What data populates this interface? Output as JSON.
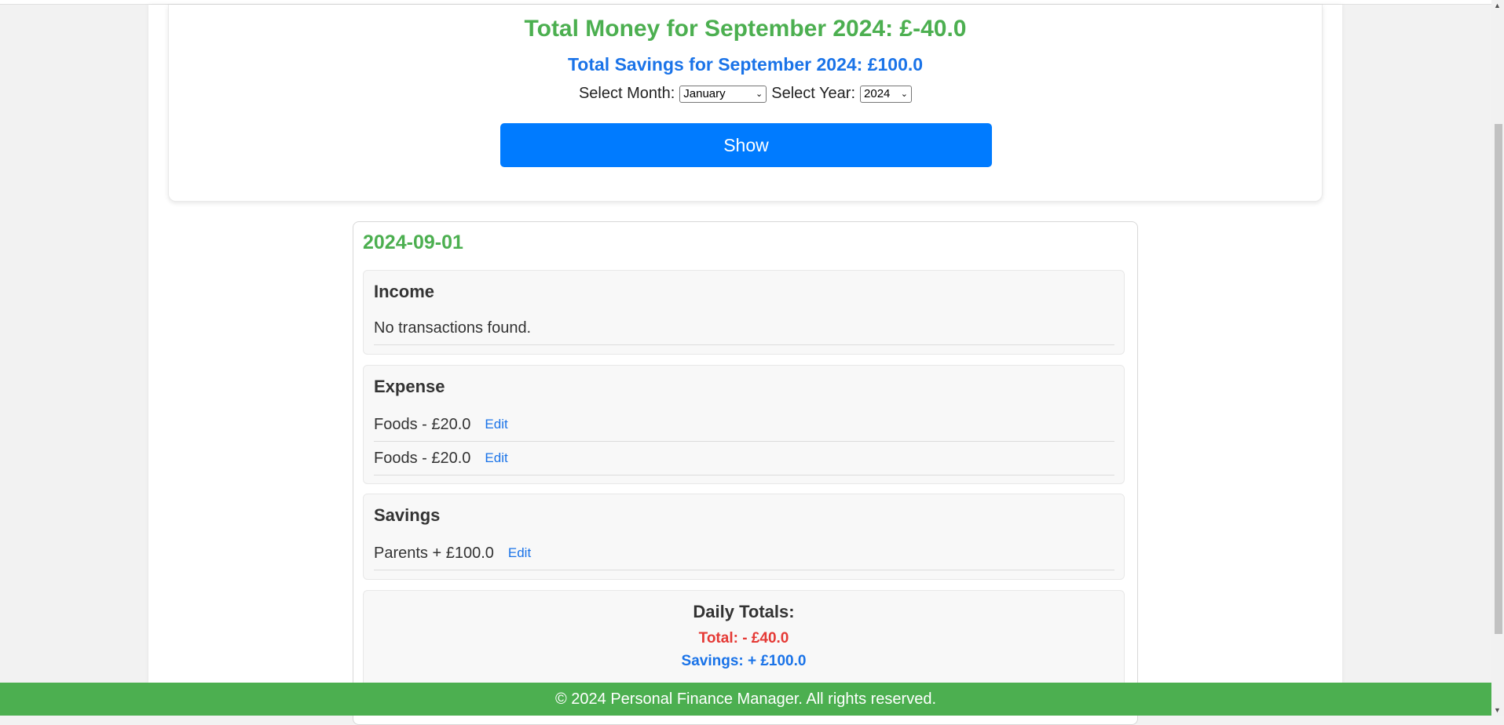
{
  "summary": {
    "total_money": "Total Money for September 2024: £-40.0",
    "total_savings": "Total Savings for September 2024: £100.0",
    "month_label": "Select Month:",
    "month_value": "January",
    "year_label": "Select Year:",
    "year_value": "2024",
    "show_label": "Show"
  },
  "day": {
    "date": "2024-09-01",
    "income": {
      "title": "Income",
      "empty_text": "No transactions found."
    },
    "expense": {
      "title": "Expense",
      "items": [
        {
          "text": "Foods - £20.0",
          "edit": "Edit"
        },
        {
          "text": "Foods - £20.0",
          "edit": "Edit"
        }
      ]
    },
    "savings": {
      "title": "Savings",
      "items": [
        {
          "text": "Parents + £100.0",
          "edit": "Edit"
        }
      ]
    },
    "daily_totals": {
      "label": "Daily Totals:",
      "total": "Total: - £40.0",
      "savings": "Savings: + £100.0"
    }
  },
  "footer": {
    "text": "© 2024 Personal Finance Manager. All rights reserved."
  },
  "colors": {
    "green": "#4caf50",
    "blue": "#007bff",
    "red": "#e53935"
  }
}
